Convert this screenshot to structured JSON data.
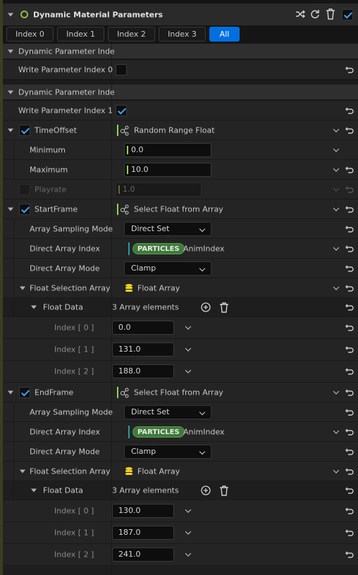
{
  "header": {
    "title": "Dynamic Material Parameters",
    "enabled": true
  },
  "tabs": [
    "Index 0",
    "Index 1",
    "Index 2",
    "Index 3",
    "All"
  ],
  "active_tab": "All",
  "sections": [
    {
      "title": "Dynamic Parameter Inde",
      "write_label": "Write Parameter Index 0",
      "write_checked": false
    },
    {
      "title": "Dynamic Parameter Inde",
      "write_label": "Write Parameter Index 1",
      "write_checked": true
    }
  ],
  "time_offset": {
    "label": "TimeOffset",
    "module": "Random Range Float",
    "minimum_label": "Minimum",
    "minimum": "0.0",
    "maximum_label": "Maximum",
    "maximum": "10.0"
  },
  "playrate": {
    "label": "Playrate",
    "value": "1.0"
  },
  "start_frame": {
    "label": "StartFrame",
    "module": "Select Float from Array",
    "sampling_label": "Array Sampling Mode",
    "sampling_value": "Direct Set",
    "direct_index_label": "Direct Array Index",
    "direct_index_badge": "PARTICLES",
    "direct_index_value": "AnimIndex",
    "direct_mode_label": "Direct Array Mode",
    "direct_mode_value": "Clamp",
    "float_sel_label": "Float Selection Array",
    "float_sel_value": "Float Array",
    "float_data_label": "Float Data",
    "float_data_count": "3 Array elements",
    "items": [
      {
        "label": "Index [ 0 ]",
        "value": "0.0"
      },
      {
        "label": "Index [ 1 ]",
        "value": "131.0"
      },
      {
        "label": "Index [ 2 ]",
        "value": "188.0"
      }
    ]
  },
  "end_frame": {
    "label": "EndFrame",
    "module": "Select Float from Array",
    "sampling_label": "Array Sampling Mode",
    "sampling_value": "Direct Set",
    "direct_index_label": "Direct Array Index",
    "direct_index_badge": "PARTICLES",
    "direct_index_value": "AnimIndex",
    "direct_mode_label": "Direct Array Mode",
    "direct_mode_value": "Clamp",
    "float_sel_label": "Float Selection Array",
    "float_sel_value": "Float Array",
    "float_data_label": "Float Data",
    "float_data_count": "3 Array elements",
    "items": [
      {
        "label": "Index [ 0 ]",
        "value": "130.0"
      },
      {
        "label": "Index [ 1 ]",
        "value": "187.0"
      },
      {
        "label": "Index [ 2 ]",
        "value": "241.0"
      }
    ]
  },
  "colors": {
    "accent": "#0070e0",
    "check": "#3ea6ff",
    "float_bar": "#8fd05c",
    "particles_badge": "#3f7b3a",
    "array_icon": "#f2d21b"
  }
}
